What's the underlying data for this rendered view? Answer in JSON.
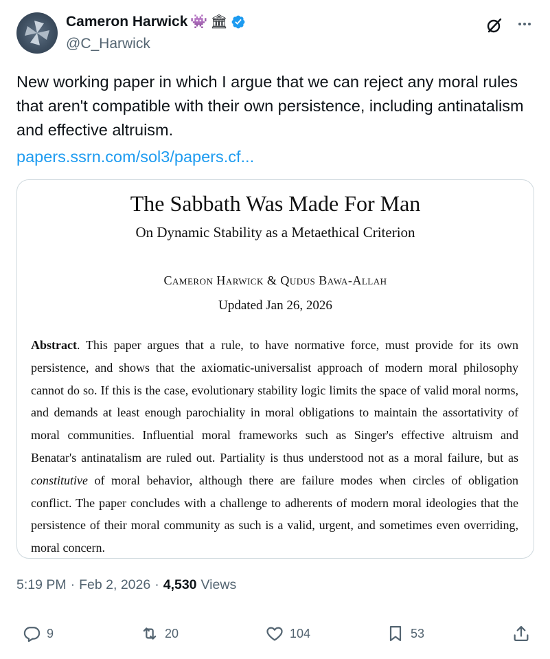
{
  "author": {
    "display_name": "Cameron Harwick",
    "emoji_1": "👾",
    "emoji_2": "🏛",
    "handle": "@C_Harwick"
  },
  "tweet": {
    "text": "New working paper in which I argue that we can reject any moral rules that aren't compatible with their own persistence, including antinatalism and effective altruism.",
    "link_text": "papers.ssrn.com/sol3/papers.cf..."
  },
  "paper": {
    "title": "The Sabbath Was Made For Man",
    "subtitle": "On Dynamic Stability as a Metaethical Criterion",
    "authors": "Cameron Harwick & Qudus Bawa-Allah",
    "date": "Updated Jan 26, 2026",
    "abstract_label": "Abstract",
    "abstract_part1": ". This paper argues that a rule, to have normative force, must provide for its own persistence, and shows that the axiomatic-universalist approach of modern moral philosophy cannot do so. If this is the case, evolutionary stability logic limits the space of valid moral norms, and demands at least enough parochiality in moral obligations to maintain the assortativity of moral communities. Influential moral frameworks such as Singer's effective altruism and Benatar's antinatalism are ruled out. Partiality is thus understood not as a moral failure, but as ",
    "abstract_em": "constitutive",
    "abstract_part2": " of moral behavior, although there are failure modes when circles of obligation conflict. The paper concludes with a challenge to adherents of modern moral ideologies that the persistence of their moral community as such is a valid, urgent, and sometimes even overriding, moral concern."
  },
  "meta": {
    "time": "5:19 PM",
    "sep1": "·",
    "date": "Feb 2, 2026",
    "sep2": "·",
    "views_count": "4,530",
    "views_label": "Views"
  },
  "actions": {
    "replies": "9",
    "reposts": "20",
    "likes": "104",
    "bookmarks": "53"
  },
  "icons": {
    "verified": "verified-badge-icon",
    "grok": "grok-icon",
    "more": "more-icon",
    "reply": "reply-icon",
    "repost": "repost-icon",
    "like": "heart-icon",
    "bookmark": "bookmark-icon",
    "share": "share-icon"
  },
  "colors": {
    "link": "#1d9bf0",
    "secondary_text": "#536471",
    "verified": "#1d9bf0"
  }
}
